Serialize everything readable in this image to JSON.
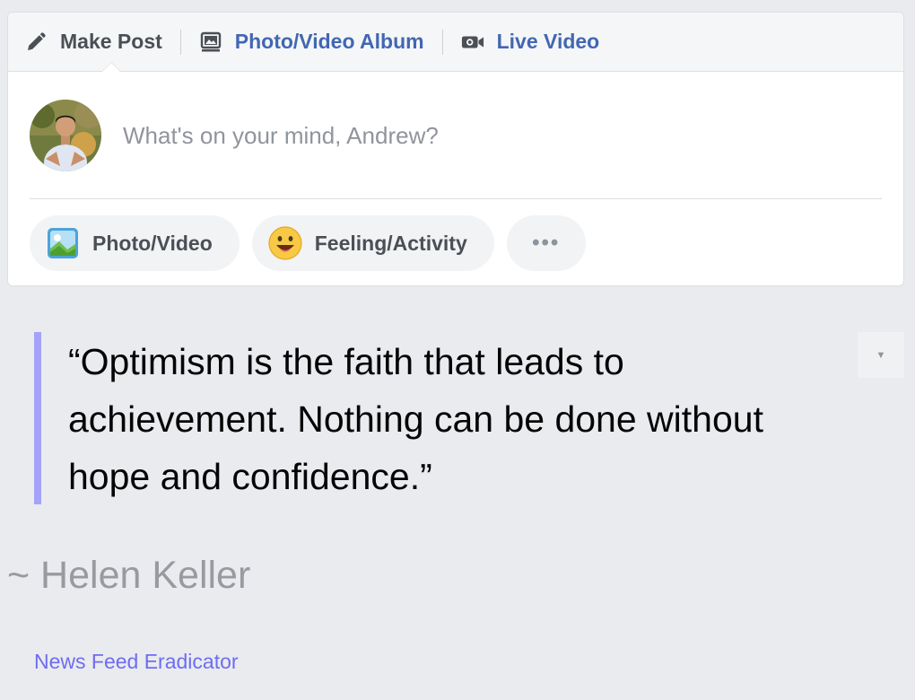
{
  "composer": {
    "tabs": [
      {
        "label": "Make Post",
        "icon": "pencil-icon"
      },
      {
        "label": "Photo/Video Album",
        "icon": "photo-album-icon"
      },
      {
        "label": "Live Video",
        "icon": "video-camera-icon"
      }
    ],
    "placeholder": "What's on your mind, Andrew?",
    "avatar_icon": "user-avatar",
    "actions": [
      {
        "label": "Photo/Video",
        "icon": "photo-icon"
      },
      {
        "label": "Feeling/Activity",
        "icon": "smiley-icon"
      },
      {
        "label": "•••",
        "icon": "more-icon"
      }
    ]
  },
  "quote": {
    "text": "“Optimism is the faith that leads to achievement. Nothing can be done without hope and confidence.”",
    "author": "~ Helen Keller",
    "dropdown_glyph": "▼"
  },
  "footer": {
    "link_text": "News Feed Eradicator"
  },
  "colors": {
    "background": "#e9ebee",
    "link_blue": "#4267b2",
    "quote_bar": "#a4a3f9",
    "footer_link": "#6e6cf3"
  }
}
